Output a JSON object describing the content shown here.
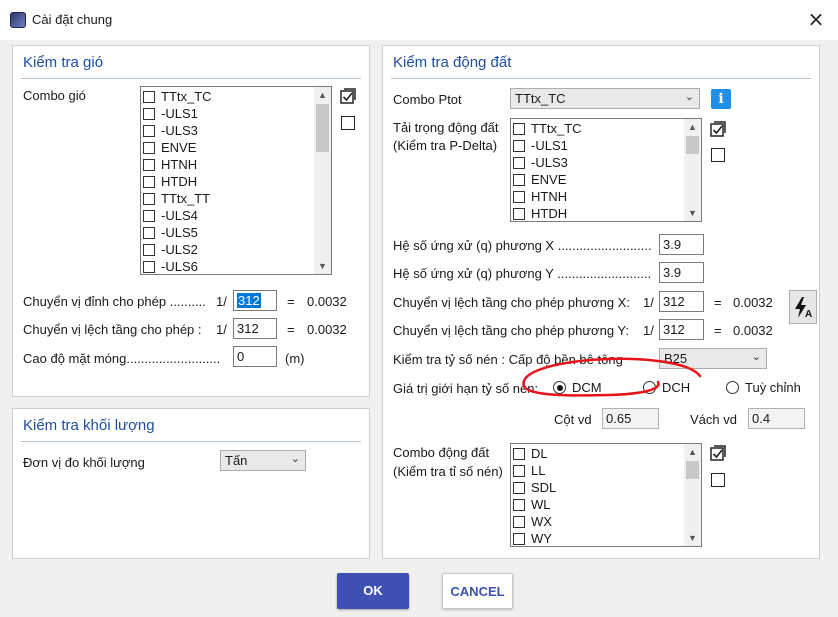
{
  "window": {
    "title": "Cài đặt chung",
    "close_glyph": "×"
  },
  "wind": {
    "title": "Kiểm tra gió",
    "combo_label": "Combo gió",
    "combos": [
      "TTtx_TC",
      "-ULS1",
      "-ULS3",
      "ENVE",
      "HTNH",
      "HTDH",
      "TTtx_TT",
      "-ULS4",
      "-ULS5",
      "-ULS2",
      "-ULS6"
    ],
    "top_drift_label": "Chuyển vị đỉnh cho phép ..........",
    "top_drift_prefix": "1/",
    "top_drift_value": "312",
    "top_drift_eq": "=",
    "top_drift_result": "0.0032",
    "story_drift_label": "Chuyển vị lệch tầng cho phép :",
    "story_drift_prefix": "1/",
    "story_drift_value": "312",
    "story_drift_eq": "=",
    "story_drift_result": "0.0032",
    "foundation_label": "Cao độ mặt móng..........................",
    "foundation_value": "0",
    "foundation_unit": "(m)"
  },
  "mass": {
    "title": "Kiểm tra khối lượng",
    "unit_label": "Đơn vị đo khối lượng",
    "unit_value": "Tấn"
  },
  "seismic": {
    "title": "Kiểm tra động đất",
    "ptot_label": "Combo Ptot",
    "ptot_value": "TTtx_TC",
    "info_glyph": "i",
    "load_label_1": "Tải trọng động đất",
    "load_label_2": "(Kiểm tra P-Delta)",
    "loads": [
      "TTtx_TC",
      "-ULS1",
      "-ULS3",
      "ENVE",
      "HTNH",
      "HTDH"
    ],
    "qx_label": "Hệ số ứng xử (q) phương X ..........................",
    "qx_value": "3.9",
    "qy_label": "Hệ số ứng xử (q) phương Y ..........................",
    "qy_value": "3.9",
    "drift_x_label": "Chuyển vị lệch tầng cho phép phương X:",
    "drift_x_prefix": "1/",
    "drift_x_value": "312",
    "drift_x_eq": "=",
    "drift_x_result": "0.0032",
    "drift_y_label": "Chuyển vị lệch tầng cho phép phương Y:",
    "drift_y_prefix": "1/",
    "drift_y_value": "312",
    "drift_y_eq": "=",
    "drift_y_result": "0.0032",
    "compress_label": "Kiểm tra tỷ số nén : Cấp độ bền bê tông",
    "concrete_grade": "B25",
    "limit_label": "Giá trị giới hạn tỷ số nén:",
    "radio_dcm": "DCM",
    "radio_dch": "DCH",
    "radio_custom": "Tuỳ chỉnh",
    "radio_selected": "DCM",
    "column_label": "Cột vd",
    "column_value": "0.65",
    "wall_label": "Vách vd",
    "wall_value": "0.4",
    "combo_quake_label_1": "Combo động đất",
    "combo_quake_label_2": "(Kiểm tra tỉ số nén)",
    "quake_combos": [
      "DL",
      "LL",
      "SDL",
      "WL",
      "WX",
      "WY"
    ]
  },
  "buttons": {
    "ok": "OK",
    "cancel": "CANCEL"
  },
  "colors": {
    "accent": "#3f51b5",
    "title_blue": "#1f4e9c",
    "annotation_red": "#e8141a",
    "info_blue": "#1e90e8"
  },
  "icons": {
    "window": "app-icon",
    "close": "close-icon",
    "select_all": "check-all-icon",
    "deselect_all": "uncheck-all-icon",
    "info": "info-icon",
    "auto": "lightning-a-icon",
    "dropdown": "chevron-down-icon"
  }
}
